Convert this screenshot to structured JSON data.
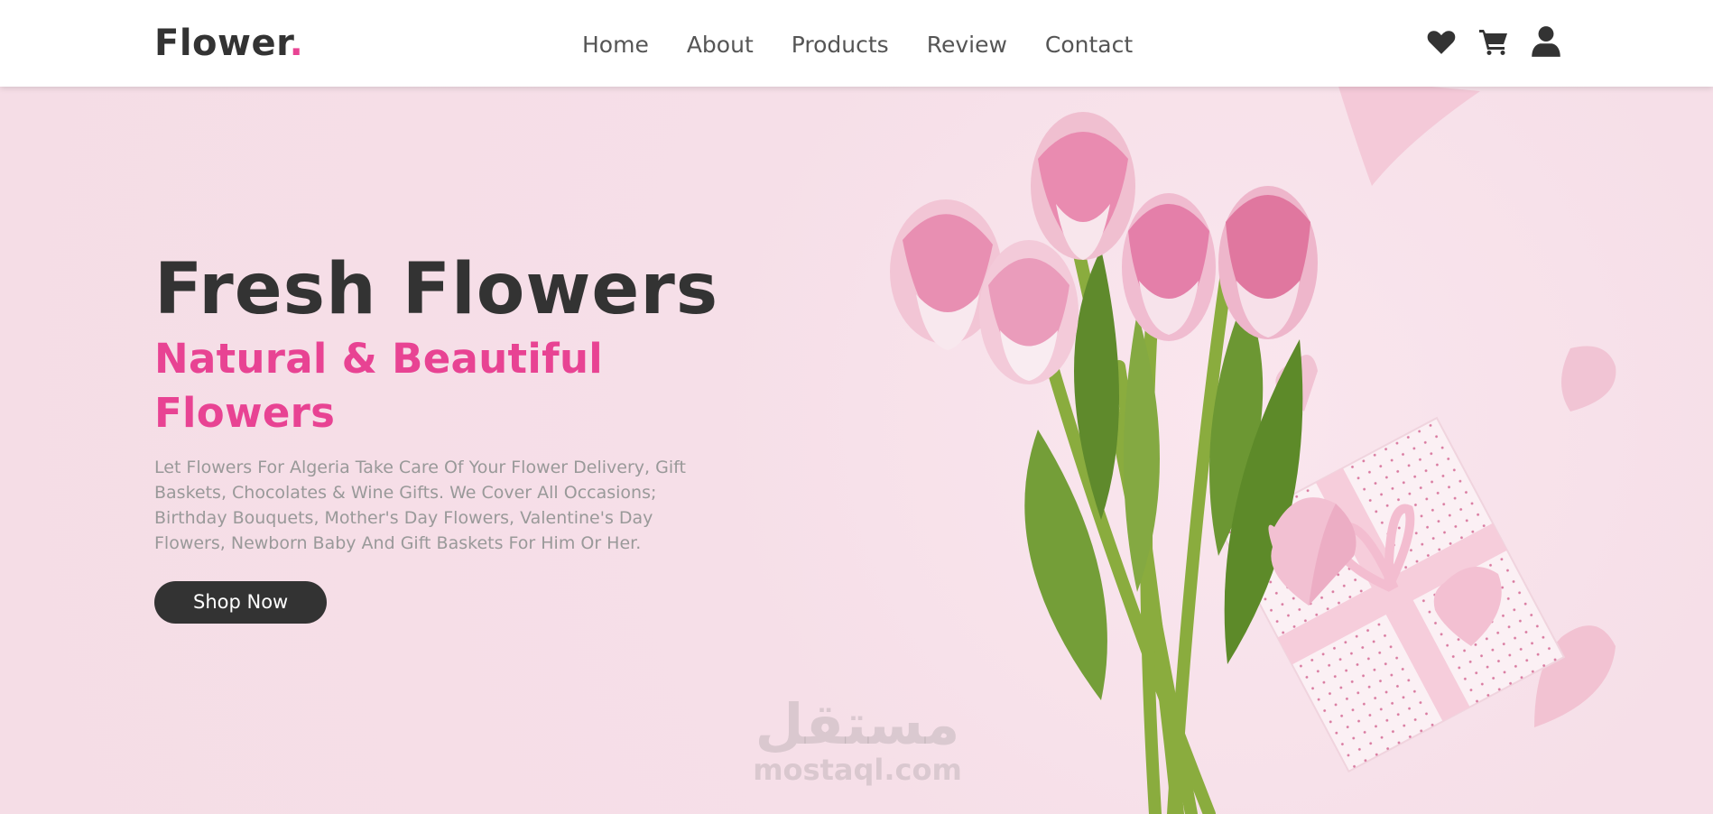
{
  "brand": {
    "name": "Flower",
    "dot": ".",
    "accent_color": "#e84393"
  },
  "nav": {
    "items": [
      {
        "label": "Home"
      },
      {
        "label": "About"
      },
      {
        "label": "Products"
      },
      {
        "label": "Review"
      },
      {
        "label": "Contact"
      }
    ]
  },
  "header_icons": [
    "heart-icon",
    "shopping-cart-icon",
    "user-icon"
  ],
  "hero": {
    "title": "Fresh Flowers",
    "subtitle": "Natural & Beautiful Flowers",
    "description": "Let Flowers For Algeria Take Care Of Your Flower Delivery, Gift Baskets, Chocolates & Wine Gifts. We Cover All Occasions; Birthday Bouquets, Mother's Day Flowers, Valentine's Day Flowers, Newborn Baby And Gift Baskets For Him Or Her.",
    "cta_label": "Shop Now"
  },
  "watermark": {
    "arabic": "مستقل",
    "latin": "mostaql.com"
  },
  "colors": {
    "background": "#f7e1ea",
    "text_dark": "#333333",
    "text_muted": "#999999"
  }
}
